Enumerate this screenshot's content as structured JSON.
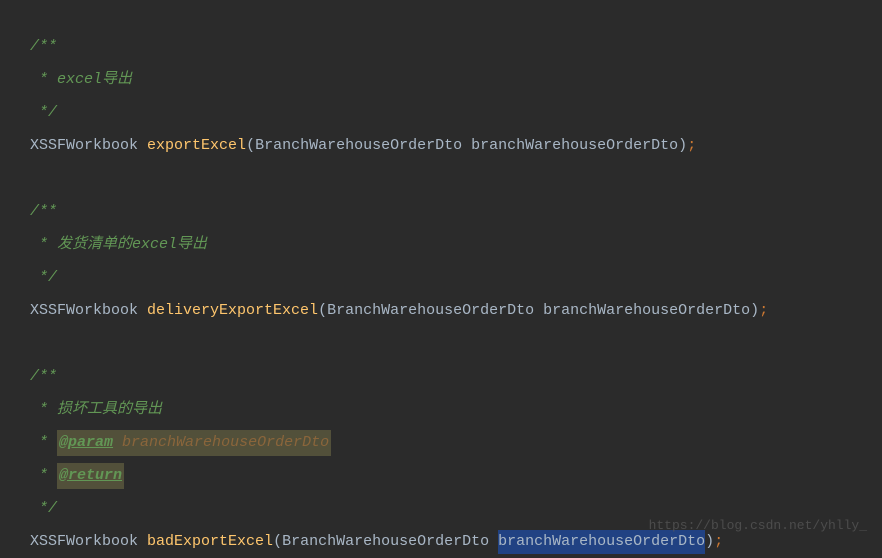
{
  "comment1": {
    "start": "/**",
    "line1": " * excel导出",
    "end": " */"
  },
  "method1": {
    "returnType": "XSSFWorkbook ",
    "name": "exportExcel",
    "openParen": "(",
    "paramType": "BranchWarehouseOrderDto ",
    "paramName": "branchWarehouseOrderDto",
    "closeParen": ")",
    "semicolon": ";"
  },
  "comment2": {
    "start": "/**",
    "line1": " * 发货清单的excel导出",
    "end": " */"
  },
  "method2": {
    "returnType": "XSSFWorkbook ",
    "name": "deliveryExportExcel",
    "openParen": "(",
    "paramType": "BranchWarehouseOrderDto ",
    "paramName": "branchWarehouseOrderDto",
    "closeParen": ")",
    "semicolon": ";"
  },
  "comment3": {
    "start": "/**",
    "line1": " * 损坏工具的导出",
    "line2_prefix": " * ",
    "line2_tag": "@param",
    "line2_space": " ",
    "line2_paramName": "branchWarehouseOrderDto",
    "line3_prefix": " * ",
    "line3_tag": "@return",
    "end": " */"
  },
  "method3": {
    "returnType": "XSSFWorkbook ",
    "name": "badExportExcel",
    "openParen": "(",
    "paramType": "BranchWarehouseOrderDto ",
    "paramName": "branchWarehouseOrderDto",
    "closeParen": ")",
    "semicolon": ";"
  },
  "watermark": "https://blog.csdn.net/yhlly_"
}
